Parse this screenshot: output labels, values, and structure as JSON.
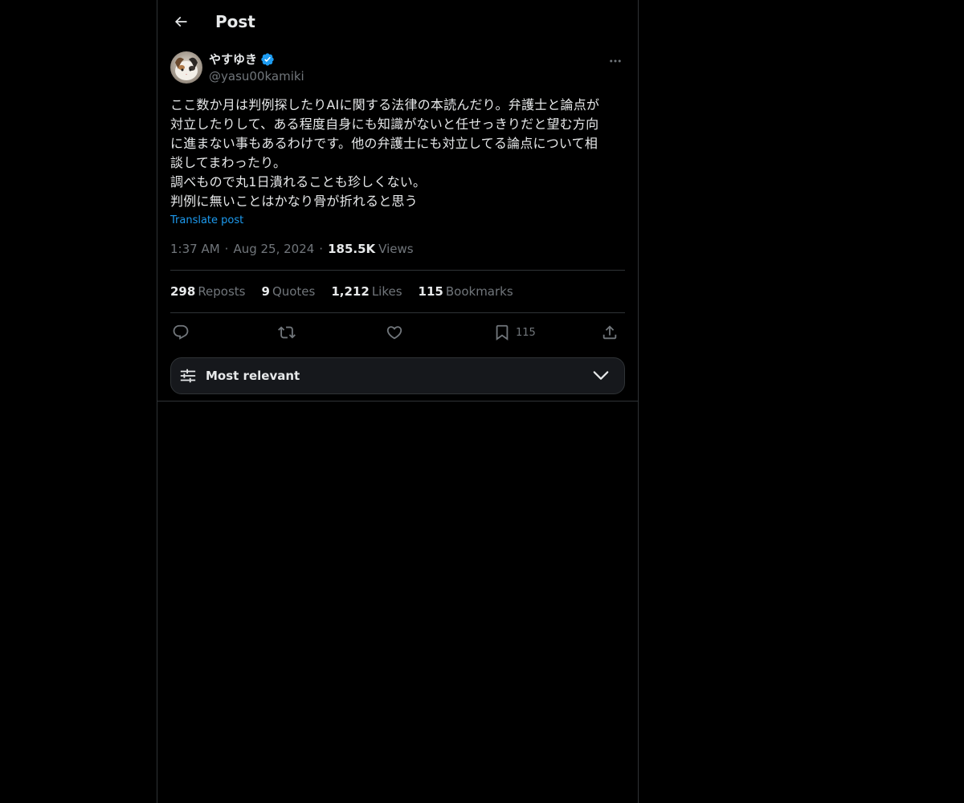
{
  "header": {
    "title": "Post",
    "back_icon": "arrow-left-icon"
  },
  "author": {
    "display_name": "やすゆき",
    "handle": "@yasu00kamiki",
    "verified": true,
    "verified_color": "#1d9bf0"
  },
  "post": {
    "text": "ここ数か月は判例探したりAIに関する法律の本読んだり。弁護士と論点が\n対立したりして、ある程度自身にも知識がないと任せっきりだと望む方向\nに進まない事もあるわけです。他の弁護士にも対立してる論点について相\n談してまわったり。\n調べもので丸1日潰れることも珍しくない。\n判例に無いことはかなり骨が折れると思う",
    "translate_label": "Translate post",
    "time": "1:37 AM",
    "separator": "·",
    "date": "Aug 25, 2024",
    "views_count": "185.5K",
    "views_label": "Views"
  },
  "stats": {
    "reposts_count": "298",
    "reposts_label": "Reposts",
    "quotes_count": "9",
    "quotes_label": "Quotes",
    "likes_count": "1,212",
    "likes_label": "Likes",
    "bookmarks_count": "115",
    "bookmarks_label": "Bookmarks"
  },
  "actions": {
    "reply_icon": "reply-icon",
    "repost_icon": "repost-icon",
    "like_icon": "heart-icon",
    "bookmark_icon": "bookmark-icon",
    "bookmark_count": "115",
    "share_icon": "share-icon"
  },
  "sort": {
    "label": "Most relevant"
  },
  "colors": {
    "background": "#000000",
    "text_primary": "#e7e9ea",
    "text_secondary": "#71767b",
    "accent": "#1d9bf0",
    "border": "#2f3336"
  }
}
